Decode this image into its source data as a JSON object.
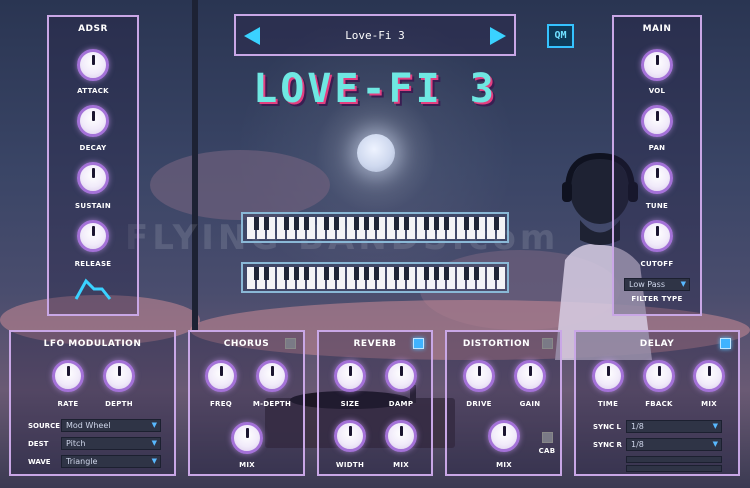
{
  "preset": {
    "name": "Love-Fi 3"
  },
  "badge": "QM",
  "logo": "LOVE-FI 3",
  "watermark": "FLYING BANDS.com",
  "adsr": {
    "title": "ADSR",
    "knobs": [
      "ATTACK",
      "DECAY",
      "SUSTAIN",
      "RELEASE"
    ]
  },
  "main": {
    "title": "MAIN",
    "knobs": [
      "VOL",
      "PAN",
      "TUNE",
      "CUTOFF"
    ],
    "filter_value": "Low Pass",
    "filter_label": "FILTER TYPE"
  },
  "lfo": {
    "title": "LFO MODULATION",
    "knobs": [
      "RATE",
      "DEPTH"
    ],
    "source_label": "SOURCE",
    "source_value": "Mod Wheel",
    "dest_label": "DEST",
    "dest_value": "Pitch",
    "wave_label": "WAVE",
    "wave_value": "Triangle"
  },
  "chorus": {
    "title": "CHORUS",
    "knobs": [
      "FREQ",
      "M-DEPTH",
      "MIX"
    ],
    "enabled": false
  },
  "reverb": {
    "title": "REVERB",
    "knobs": [
      "SIZE",
      "DAMP",
      "WIDTH",
      "MIX"
    ],
    "enabled": true
  },
  "distortion": {
    "title": "DISTORTION",
    "knobs": [
      "DRIVE",
      "GAIN",
      "MIX"
    ],
    "cab_label": "CAB",
    "enabled": false
  },
  "delay": {
    "title": "DELAY",
    "knobs": [
      "TIME",
      "FBACK",
      "MIX"
    ],
    "sync_l_label": "SYNC L",
    "sync_l_value": "1/8",
    "sync_r_label": "SYNC R",
    "sync_r_value": "1/8",
    "enabled": true
  },
  "colors": {
    "panel_border": "#c9a7e6",
    "knob_ring": "#a472d8",
    "accent": "#3ad2ff",
    "logo": "#6fe8e2"
  }
}
